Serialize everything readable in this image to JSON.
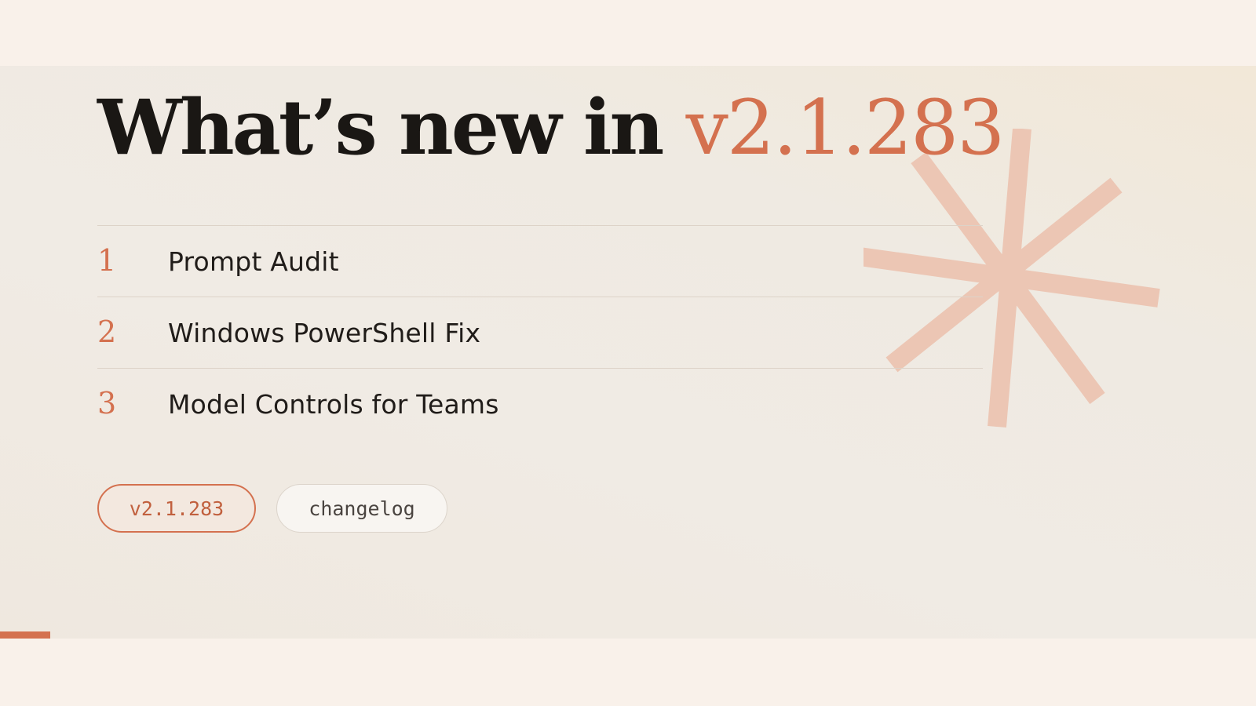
{
  "header": {
    "title_prefix": "What’s new in ",
    "title_version": "v2.1.283"
  },
  "features": [
    {
      "number": "1",
      "label": "Prompt Audit"
    },
    {
      "number": "2",
      "label": "Windows PowerShell Fix"
    },
    {
      "number": "3",
      "label": "Model Controls for Teams"
    }
  ],
  "tags": {
    "version": "v2.1.283",
    "changelog": "changelog"
  },
  "icons": {
    "decoration": "asterisk-icon"
  },
  "colors": {
    "accent": "#d4714f",
    "text": "#1a1714",
    "background": "#f9f1ea",
    "asterisk": "#ecc3b0"
  }
}
